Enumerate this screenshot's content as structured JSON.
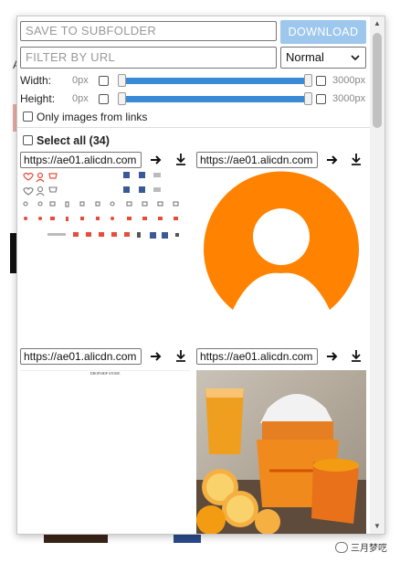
{
  "background": {
    "fragment_text": "A",
    "watermark": "三月梦呓"
  },
  "popup": {
    "subfolder": {
      "placeholder": "SAVE TO SUBFOLDER"
    },
    "download_label": "DOWNLOAD",
    "filter": {
      "placeholder": "FILTER BY URL"
    },
    "filter_mode": {
      "value": "Normal"
    },
    "width": {
      "label": "Width:",
      "min_label": "0px",
      "max_label": "3000px",
      "min_value": 0,
      "max_value": 3000
    },
    "height": {
      "label": "Height:",
      "min_label": "0px",
      "max_label": "3000px",
      "min_value": 0,
      "max_value": 3000
    },
    "only_links_label": "Only images from links",
    "select_all_label": "Select all (34)",
    "images": [
      {
        "url": "https://ae01.alicdn.com",
        "kind": "icon-sprite"
      },
      {
        "url": "https://ae01.alicdn.com",
        "kind": "orange-logo"
      },
      {
        "url": "https://ae01.alicdn.com",
        "kind": "document-strip",
        "caption": "DROPSHIP STORE"
      },
      {
        "url": "https://ae01.alicdn.com",
        "kind": "juicer-photo"
      }
    ]
  },
  "colors": {
    "accent": "#3a8ad6",
    "download_bg": "#9dc7ec",
    "logo_orange": "#ff8200"
  }
}
